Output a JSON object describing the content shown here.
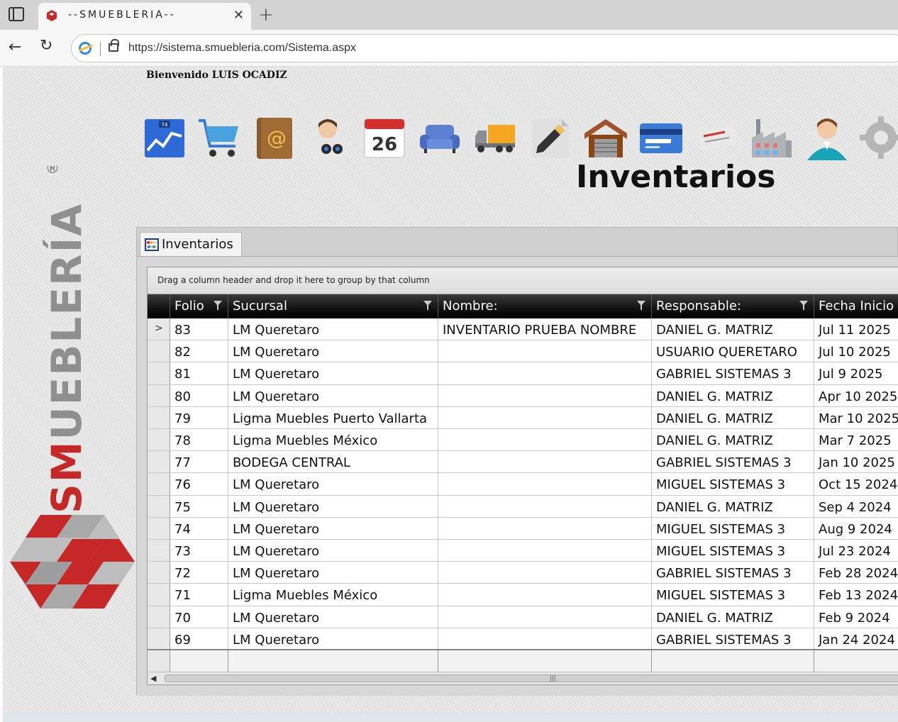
{
  "browser": {
    "tab_title": "--SMUEBLERIA--",
    "tab_close": "✕",
    "new_tab": "+",
    "back": "←",
    "reload": "↻",
    "url": "https://sistema.smuebleria.com/Sistema.aspx"
  },
  "page": {
    "welcome": "Bienvenido LUIS OCADIZ",
    "title": "Inventarios",
    "logo_text": "SMUEBLERÍA",
    "logo_registered": "®"
  },
  "toolbar": {
    "items": [
      {
        "icon": "dashboard-chart-icon",
        "badge": "74"
      },
      {
        "icon": "shopping-cart-icon"
      },
      {
        "icon": "address-book-icon",
        "glyph": "@"
      },
      {
        "icon": "customer-search-icon"
      },
      {
        "icon": "calendar-icon",
        "day": "26"
      },
      {
        "icon": "sofa-icon"
      },
      {
        "icon": "delivery-truck-icon"
      },
      {
        "icon": "edit-pencil-icon"
      },
      {
        "icon": "warehouse-icon"
      },
      {
        "icon": "credit-card-icon"
      },
      {
        "icon": "check-payment-icon"
      },
      {
        "icon": "factory-icon"
      },
      {
        "icon": "user-profile-icon"
      },
      {
        "icon": "settings-gear-icon"
      }
    ]
  },
  "panel": {
    "tab_label": "Inventarios",
    "group_hint": "Drag a column header and drop it here to group by that column",
    "columns": [
      "Folio",
      "Sucursal",
      "Nombre:",
      "Responsable:",
      "Fecha Inicio"
    ],
    "rows": [
      {
        "folio": "83",
        "sucursal": "LM Queretaro",
        "nombre": "INVENTARIO PRUEBA NOMBRE",
        "responsable": "DANIEL G. MATRIZ",
        "fecha": "Jul 11 2025"
      },
      {
        "folio": "82",
        "sucursal": "LM Queretaro",
        "nombre": "",
        "responsable": "USUARIO QUERETARO",
        "fecha": "Jul 10 2025"
      },
      {
        "folio": "81",
        "sucursal": "LM Queretaro",
        "nombre": "",
        "responsable": "GABRIEL SISTEMAS 3",
        "fecha": "Jul  9 2025"
      },
      {
        "folio": "80",
        "sucursal": "LM Queretaro",
        "nombre": "",
        "responsable": "DANIEL G. MATRIZ",
        "fecha": "Apr 10 2025"
      },
      {
        "folio": "79",
        "sucursal": "Ligma Muebles Puerto Vallarta",
        "nombre": "",
        "responsable": "DANIEL G. MATRIZ",
        "fecha": "Mar 10 2025"
      },
      {
        "folio": "78",
        "sucursal": "Ligma Muebles México",
        "nombre": "",
        "responsable": "DANIEL G. MATRIZ",
        "fecha": "Mar  7 2025"
      },
      {
        "folio": "77",
        "sucursal": "BODEGA CENTRAL",
        "nombre": "",
        "responsable": "GABRIEL SISTEMAS 3",
        "fecha": "Jan 10 2025"
      },
      {
        "folio": "76",
        "sucursal": "LM Queretaro",
        "nombre": "",
        "responsable": "MIGUEL SISTEMAS 3",
        "fecha": "Oct 15 2024"
      },
      {
        "folio": "75",
        "sucursal": "LM Queretaro",
        "nombre": "",
        "responsable": "DANIEL G. MATRIZ",
        "fecha": "Sep  4 2024"
      },
      {
        "folio": "74",
        "sucursal": "LM Queretaro",
        "nombre": "",
        "responsable": "MIGUEL SISTEMAS 3",
        "fecha": "Aug  9 2024"
      },
      {
        "folio": "73",
        "sucursal": "LM Queretaro",
        "nombre": "",
        "responsable": "MIGUEL SISTEMAS 3",
        "fecha": "Jul 23 2024"
      },
      {
        "folio": "72",
        "sucursal": "LM Queretaro",
        "nombre": "",
        "responsable": "GABRIEL SISTEMAS 3",
        "fecha": "Feb 28 2024"
      },
      {
        "folio": "71",
        "sucursal": "Ligma Muebles México",
        "nombre": "",
        "responsable": "MIGUEL SISTEMAS 3",
        "fecha": "Feb 13 2024"
      },
      {
        "folio": "70",
        "sucursal": "LM Queretaro",
        "nombre": "",
        "responsable": "DANIEL G. MATRIZ",
        "fecha": "Feb  9 2024"
      },
      {
        "folio": "69",
        "sucursal": "LM Queretaro",
        "nombre": "",
        "responsable": "GABRIEL SISTEMAS 3",
        "fecha": "Jan 24 2024"
      }
    ],
    "current_row_marker": ">"
  },
  "colors": {
    "brand_red": "#c62828",
    "brand_gray": "#9e9e9e",
    "header_bg": "#111111"
  }
}
